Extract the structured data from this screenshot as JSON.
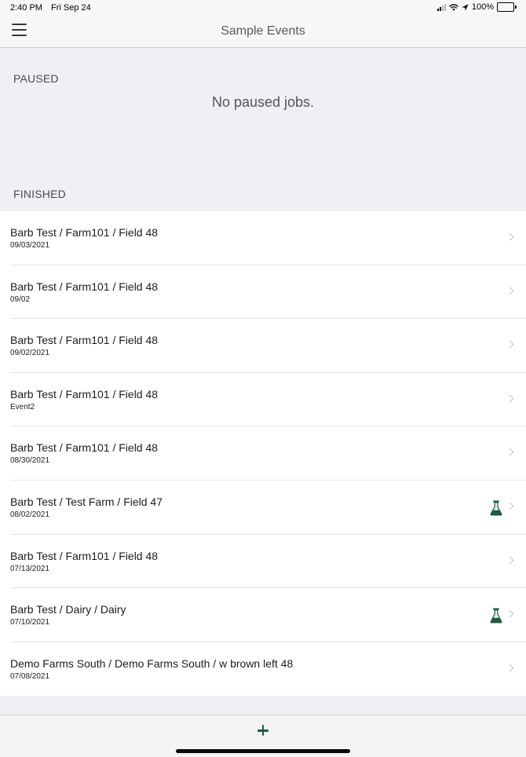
{
  "status_bar": {
    "time": "2:40 PM",
    "date": "Fri Sep 24",
    "battery": "100%",
    "battery_level": 1.0
  },
  "nav": {
    "title": "Sample Events"
  },
  "paused": {
    "header": "PAUSED",
    "empty_text": "No paused jobs."
  },
  "finished": {
    "header": "FINISHED",
    "items": [
      {
        "title": "Barb Test / Farm101 / Field 48",
        "subtitle": "09/03/2021",
        "lab": false
      },
      {
        "title": "Barb Test / Farm101 / Field 48",
        "subtitle": "09/02",
        "lab": false
      },
      {
        "title": "Barb Test / Farm101 / Field 48",
        "subtitle": "09/02/2021",
        "lab": false
      },
      {
        "title": "Barb Test / Farm101 / Field 48",
        "subtitle": "Event2",
        "lab": false
      },
      {
        "title": "Barb Test / Farm101 / Field 48",
        "subtitle": "08/30/2021",
        "lab": false
      },
      {
        "title": "Barb Test / Test Farm / Field 47",
        "subtitle": "08/02/2021",
        "lab": true
      },
      {
        "title": "Barb Test / Farm101 / Field 48",
        "subtitle": "07/13/2021",
        "lab": false
      },
      {
        "title": "Barb Test / Dairy / Dairy",
        "subtitle": "07/10/2021",
        "lab": true
      },
      {
        "title": "Demo Farms South / Demo Farms South / w brown left 48",
        "subtitle": "07/08/2021",
        "lab": false
      }
    ]
  },
  "icons": {
    "menu": "hamburger-menu-icon",
    "chevron": "chevron-right-icon",
    "lab": "lab-flask-icon",
    "add": "plus-icon",
    "signal": "cellular-signal-icon",
    "wifi": "wifi-icon",
    "location": "location-arrow-icon",
    "battery": "battery-icon"
  },
  "colors": {
    "accent": "#1f5c3c",
    "background": "#efeff4",
    "list_background": "#ffffff",
    "chevron": "#c4c4c7",
    "battery_fill": "#34c759"
  }
}
